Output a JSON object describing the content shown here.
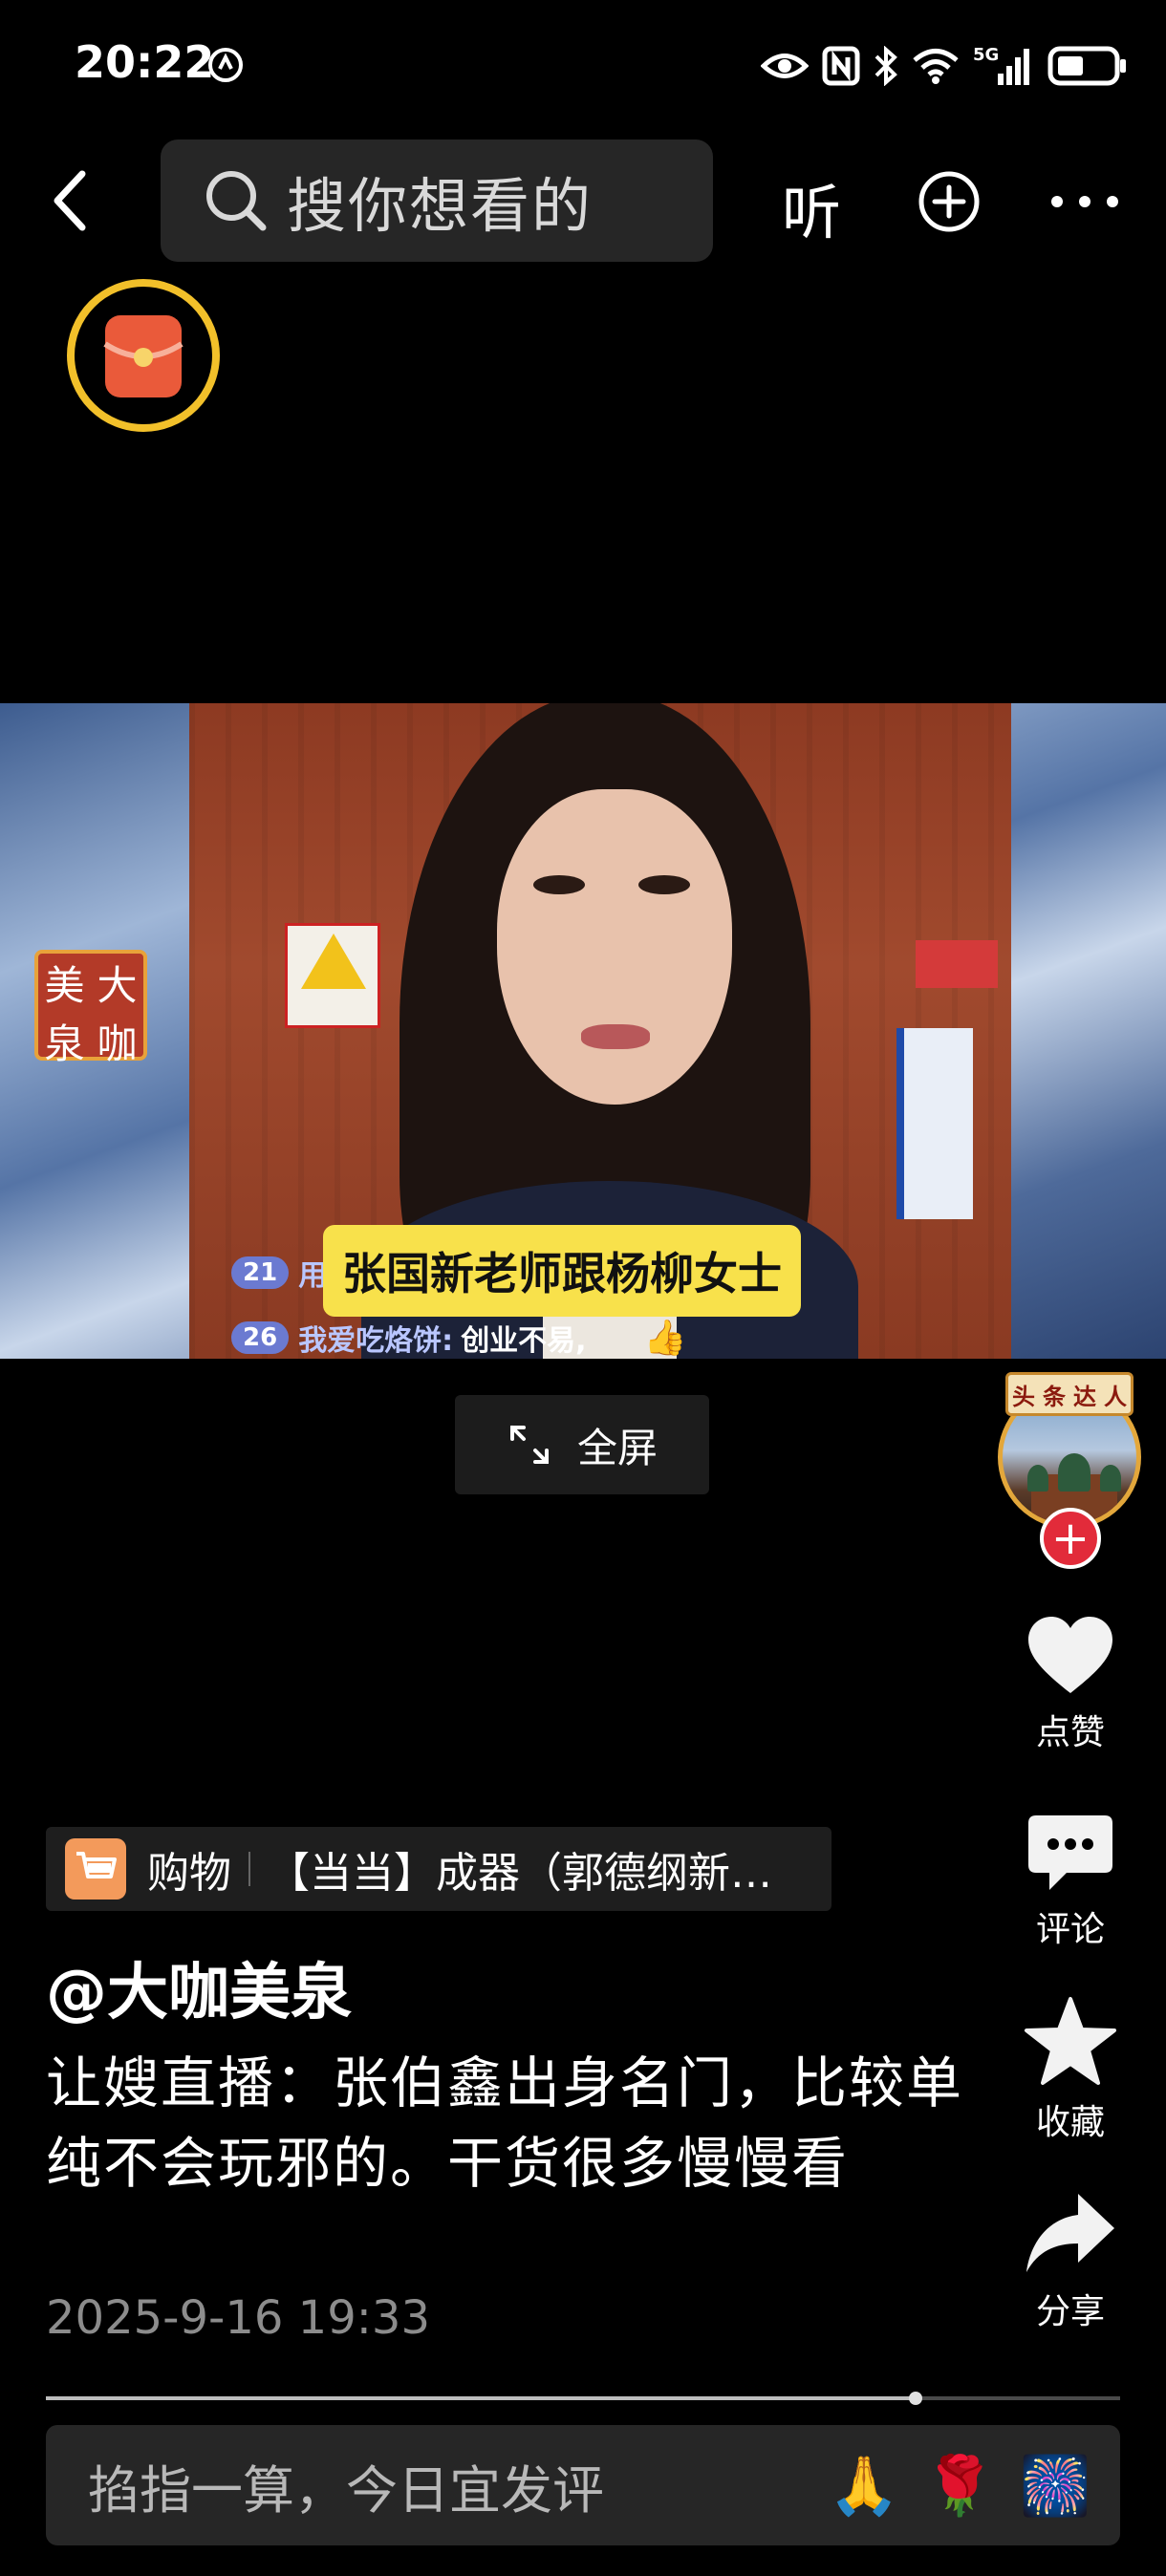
{
  "status_bar": {
    "time": "20:22",
    "network": "5G",
    "icons": [
      "app-notification-icon",
      "eye-icon",
      "nfc-icon",
      "bluetooth-icon",
      "wifi-icon",
      "signal-icon",
      "battery-icon"
    ]
  },
  "nav": {
    "search_placeholder": "搜你想看的",
    "listen_label": "听"
  },
  "video": {
    "logo_seal": [
      "美",
      "大",
      "泉",
      "咖"
    ],
    "caption": "张国新老师跟杨柳女士",
    "chat": [
      {
        "level": "21",
        "name": "用",
        "message": ""
      },
      {
        "level": "26",
        "name": "我爱吃烙饼:",
        "message": "创业不易,"
      }
    ]
  },
  "fullscreen_label": "全屏",
  "author": {
    "badge_chars": [
      "头",
      "条",
      "达",
      "人"
    ],
    "handle": "@大咖美泉"
  },
  "actions": {
    "like": "点赞",
    "comment": "评论",
    "favorite": "收藏",
    "share": "分享"
  },
  "product": {
    "category": "购物",
    "title": "【当当】成器（郭德纲新…"
  },
  "post": {
    "description": "让嫂直播：张伯鑫出身名门，比较单纯不会玩邪的。干货很多慢慢看",
    "timestamp": "2025-9-16 19:33",
    "progress": 0.81
  },
  "comment_bar": {
    "placeholder": "掐指一算，今日宜发评",
    "emojis": [
      "🙏",
      "🌹",
      "🎆"
    ]
  },
  "colors": {
    "background": "#000000",
    "caption_bg": "#f8e14b",
    "follow": "#e22b3a",
    "red_packet_ring": "#f2c02a"
  }
}
